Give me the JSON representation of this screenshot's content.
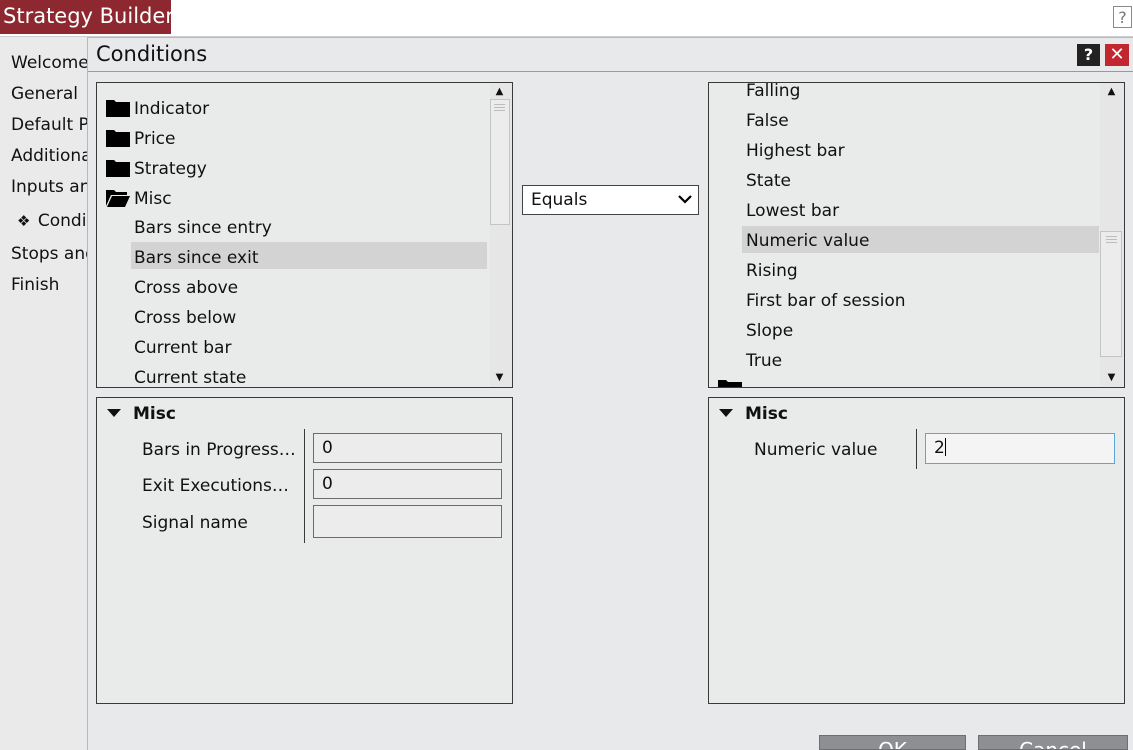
{
  "app": {
    "title": "Strategy Builder",
    "help_label": "?"
  },
  "nav": {
    "items": [
      {
        "label": "Welcome"
      },
      {
        "label": "General"
      },
      {
        "label": "Default P"
      },
      {
        "label": "Additiona"
      },
      {
        "label": "Inputs anc"
      },
      {
        "label": "Condi",
        "active": true,
        "marker": "❖"
      },
      {
        "label": "Stops and"
      },
      {
        "label": "Finish"
      }
    ]
  },
  "dialog": {
    "title": "Conditions",
    "help_label": "?",
    "close_label": "✕",
    "left_tree": {
      "folders": [
        "Indicator",
        "Price",
        "Strategy",
        "Misc"
      ],
      "items": [
        "Bars since entry",
        "Bars since exit",
        "Cross above",
        "Cross below",
        "Current bar",
        "Current state"
      ],
      "selected": "Bars since exit"
    },
    "operator": {
      "value": "Equals"
    },
    "right_list": {
      "items": [
        "Falling",
        "False",
        "Highest bar",
        "State",
        "Lowest bar",
        "Numeric value",
        "Rising",
        "First bar of session",
        "Slope",
        "True"
      ],
      "selected": "Numeric value"
    },
    "left_props": {
      "header": "Misc",
      "rows": [
        {
          "label": "Bars in Progress…",
          "value": "0"
        },
        {
          "label": "Exit Executions…",
          "value": "0"
        },
        {
          "label": "Signal name",
          "value": ""
        }
      ]
    },
    "right_props": {
      "header": "Misc",
      "rows": [
        {
          "label": "Numeric value",
          "value": "2"
        }
      ]
    },
    "buttons": {
      "ok": "OK",
      "cancel": "Cancel"
    }
  },
  "colors": {
    "title_tab": "#8e2830",
    "close": "#c2262e",
    "selection": "#d3d3d3",
    "focus_border": "#5aa7d6"
  }
}
